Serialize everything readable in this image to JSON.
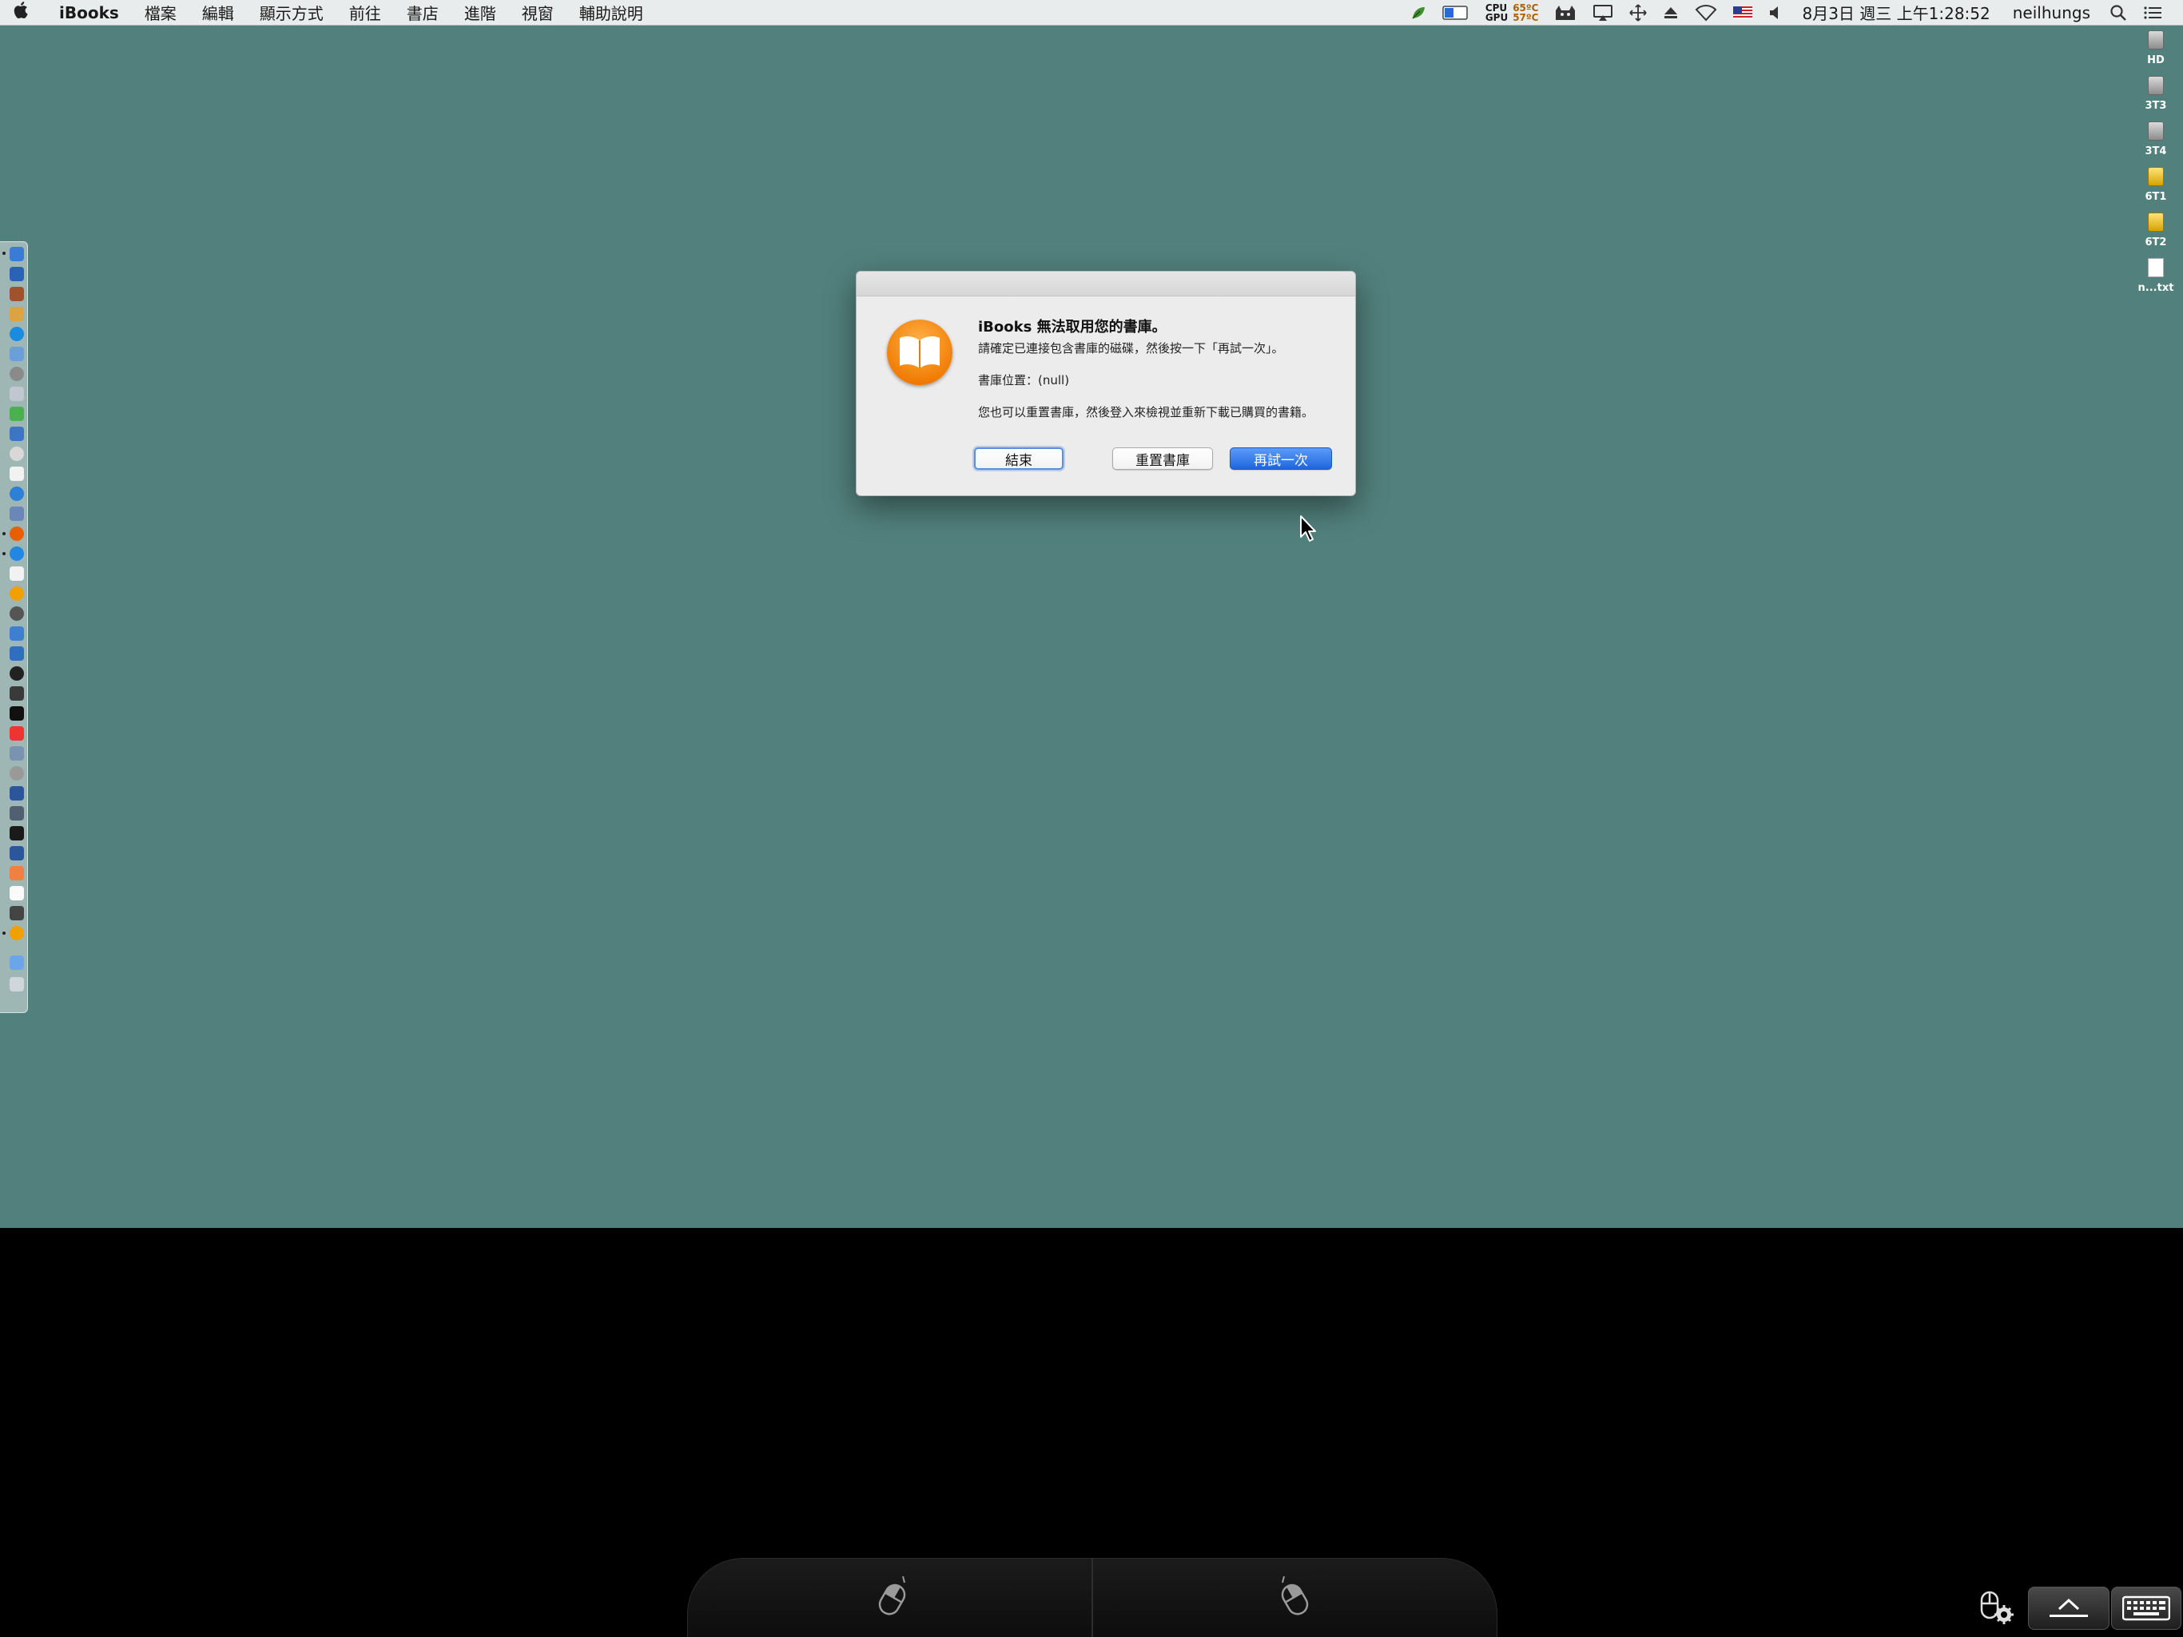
{
  "menubar": {
    "apple_icon": "apple-icon",
    "app_name": "iBooks",
    "menus": [
      "檔案",
      "編輯",
      "顯示方式",
      "前往",
      "書店",
      "進階",
      "視窗",
      "輔助說明"
    ],
    "status": {
      "cpu_label": "CPU",
      "gpu_label": "GPU",
      "cpu_temp": "65ºC",
      "gpu_temp": "57ºC",
      "clock": "8月3日 週三 上午1:28:52",
      "user": "neilhungs"
    }
  },
  "desktop_items": [
    {
      "label": "HD",
      "icon": "drive-icon"
    },
    {
      "label": "3T3",
      "icon": "drive-icon"
    },
    {
      "label": "3T4",
      "icon": "drive-icon"
    },
    {
      "label": "6T1",
      "icon": "external-drive-icon"
    },
    {
      "label": "6T2",
      "icon": "external-drive-icon"
    },
    {
      "label": "n...txt",
      "icon": "text-file-icon"
    }
  ],
  "dialog": {
    "title": "iBooks 無法取用您的書庫。",
    "message1": "請確定已連接包含書庫的磁碟，然後按一下「再試一次」。",
    "message2": "書庫位置：(null)",
    "message3": "您也可以重置書庫，然後登入來檢視並重新下載已購買的書籍。",
    "buttons": {
      "quit": "結束",
      "reset": "重置書庫",
      "retry": "再試一次"
    }
  },
  "colors": {
    "desktop": "#52817d",
    "primary_button": "#1e66e0",
    "ibooks_orange": "#f07a00"
  }
}
